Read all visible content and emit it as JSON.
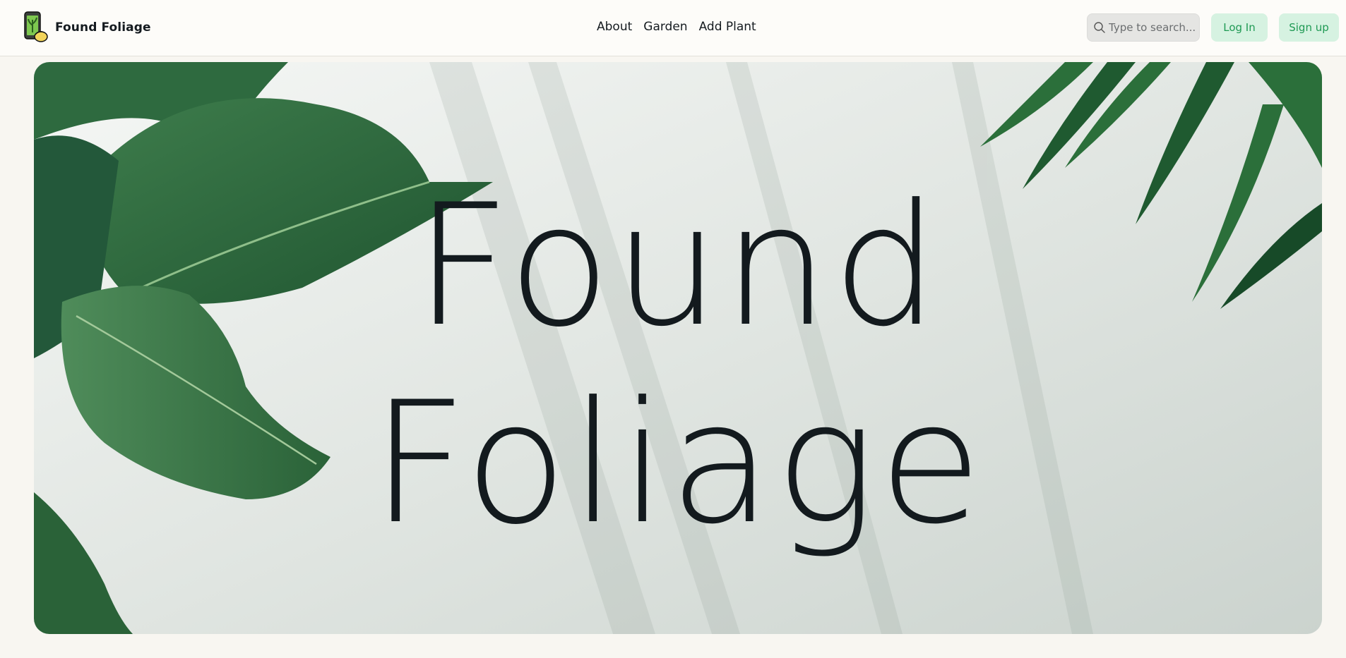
{
  "brand": {
    "name": "Found Foliage",
    "logo_icon": "phone-plant-logo-icon"
  },
  "nav": {
    "items": [
      {
        "label": "About"
      },
      {
        "label": "Garden"
      },
      {
        "label": "Add Plant"
      }
    ]
  },
  "search": {
    "placeholder": "Type to search...",
    "value": "",
    "icon": "search-icon"
  },
  "auth": {
    "login_label": "Log In",
    "signup_label": "Sign up"
  },
  "hero": {
    "title_line1": "Found",
    "title_line2": "Foliage"
  },
  "colors": {
    "background": "#f8f6f1",
    "button_bg": "#d6f2e1",
    "button_text": "#1f9a54",
    "leaf_green": "#2f6b40",
    "text": "#131a1e"
  }
}
